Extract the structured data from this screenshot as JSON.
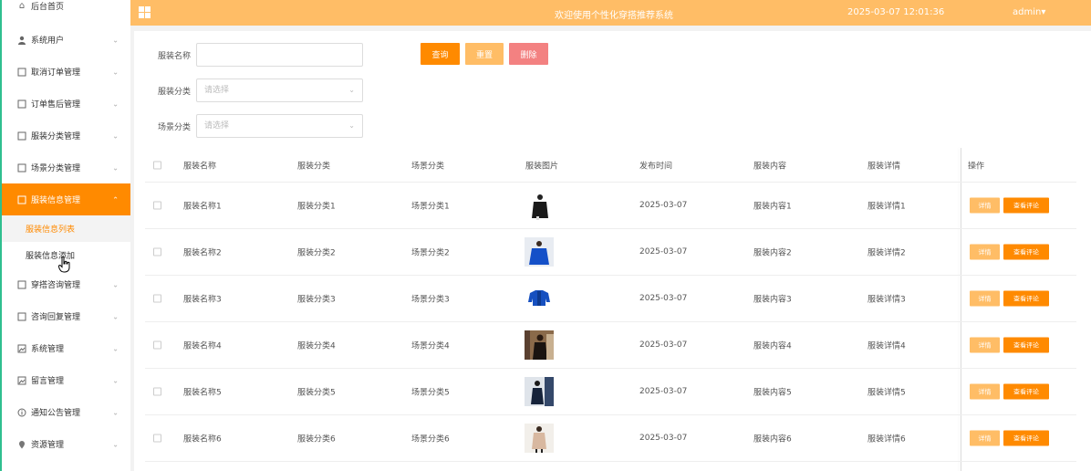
{
  "header": {
    "title": "欢迎使用个性化穿搭推荐系统",
    "time": "2025-03-07 12:01:36",
    "user": "admin",
    "user_caret": "▾"
  },
  "sidebar": {
    "items": [
      {
        "label": "后台首页",
        "icon": "home-icon",
        "glyph": "⌂"
      },
      {
        "label": "系统用户",
        "icon": "user-icon",
        "glyph": "👤"
      },
      {
        "label": "取消订单管理",
        "icon": "document-icon",
        "glyph": "▢"
      },
      {
        "label": "订单售后管理",
        "icon": "document-icon",
        "glyph": "▢"
      },
      {
        "label": "服装分类管理",
        "icon": "document-icon",
        "glyph": "▢"
      },
      {
        "label": "场景分类管理",
        "icon": "document-icon",
        "glyph": "▢"
      },
      {
        "label": "服装信息管理",
        "icon": "document-icon",
        "glyph": "▢"
      },
      {
        "label": "穿搭咨询管理",
        "icon": "document-icon",
        "glyph": "▢"
      },
      {
        "label": "咨询回复管理",
        "icon": "document-icon",
        "glyph": "▢"
      },
      {
        "label": "系统管理",
        "icon": "image-icon",
        "glyph": "▣"
      },
      {
        "label": "留言管理",
        "icon": "image-icon",
        "glyph": "▣"
      },
      {
        "label": "通知公告管理",
        "icon": "info-icon",
        "glyph": "ⓘ"
      },
      {
        "label": "资源管理",
        "icon": "location-icon",
        "glyph": "●"
      }
    ],
    "sub_items": [
      "服装信息列表",
      "服装信息添加"
    ],
    "chevron_down": "⌄",
    "chevron_up": "⌃"
  },
  "search": {
    "name_label": "服装名称",
    "name_value": "",
    "category_label": "服装分类",
    "category_placeholder": "请选择",
    "scene_label": "场景分类",
    "scene_placeholder": "请选择",
    "query_btn": "查询",
    "reset_btn": "重置",
    "delete_btn": "删除"
  },
  "table": {
    "columns": [
      "服装名称",
      "服装分类",
      "场景分类",
      "服装图片",
      "发布时间",
      "服装内容",
      "服装详情",
      "操作"
    ],
    "rows": [
      {
        "name": "服装名称1",
        "category": "服装分类1",
        "scene": "场景分类1",
        "date": "2025-03-07",
        "content": "服装内容1",
        "detail": "服装详情1"
      },
      {
        "name": "服装名称2",
        "category": "服装分类2",
        "scene": "场景分类2",
        "date": "2025-03-07",
        "content": "服装内容2",
        "detail": "服装详情2"
      },
      {
        "name": "服装名称3",
        "category": "服装分类3",
        "scene": "场景分类3",
        "date": "2025-03-07",
        "content": "服装内容3",
        "detail": "服装详情3"
      },
      {
        "name": "服装名称4",
        "category": "服装分类4",
        "scene": "场景分类4",
        "date": "2025-03-07",
        "content": "服装内容4",
        "detail": "服装详情4"
      },
      {
        "name": "服装名称5",
        "category": "服装分类5",
        "scene": "场景分类5",
        "date": "2025-03-07",
        "content": "服装内容5",
        "detail": "服装详情5"
      },
      {
        "name": "服装名称6",
        "category": "服装分类6",
        "scene": "场景分类6",
        "date": "2025-03-07",
        "content": "服装内容6",
        "detail": "服装详情6"
      }
    ],
    "detail_btn": "详情",
    "review_btn": "查看评论"
  },
  "colors": {
    "accent": "#ff8a00",
    "header_bg": "#ffbd66",
    "delete": "#f38181"
  }
}
